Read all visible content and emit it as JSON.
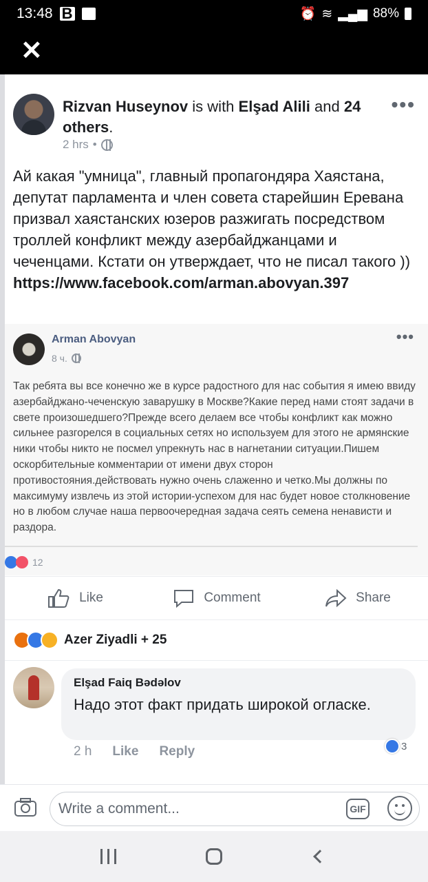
{
  "status_bar": {
    "time": "13:48",
    "battery": "88%"
  },
  "post": {
    "author": "Rizvan Huseynov",
    "with_text": "is with",
    "tagged": "Elşad Alili",
    "and_text": "and",
    "others": "24 others",
    "period": ".",
    "time": "2 hrs",
    "dot": "•",
    "text": "Ай какая \"умница\", главный пропагондяра Хаястана, депутат парламента и член совета старейшин Еревана призвал хаястанских юзеров разжигать посредством троллей конфликт между азербайджанцами и чеченцами. Кстати он утверждает, что не писал такого ))",
    "link": "https://www.facebook.com/arman.abovyan.397"
  },
  "shared": {
    "author": "Arman Abovyan",
    "time": "8 ч.",
    "text": "Так ребята вы все конечно же в курсе радостного для нас события я имею ввиду азербайджано-чеченскую заварушку в Москве?Какие перед нами стоят задачи в свете произошедшего?Прежде всего делаем все чтобы конфликт как можно сильнее разгорелся в социальных сетях но используем для этого не армянские ники чтобы никто не посмел упрекнуть нас в нагнетании ситуации.Пишем оскорбительные комментарии от имени двух сторон противостояния.действовать нужно очень слаженно и четко.Мы должны по максимуму извлечь из этой истории-успехом для нас будет новое столкновение но в любом случае наша первоочередная задача сеять семена ненависти и раздора.",
    "reaction_count": "12"
  },
  "actions": {
    "like": "Like",
    "comment": "Comment",
    "share": "Share"
  },
  "reactions": {
    "names": "Azer Ziyadli + 25"
  },
  "comment": {
    "author": "Elşad Faiq Bədəlov",
    "text": "Надо этот факт придать широкой огласке.",
    "time": "2 h",
    "like": "Like",
    "reply": "Reply",
    "reaction_count": "3"
  },
  "composer": {
    "placeholder": "Write a comment...",
    "gif": "GIF"
  }
}
